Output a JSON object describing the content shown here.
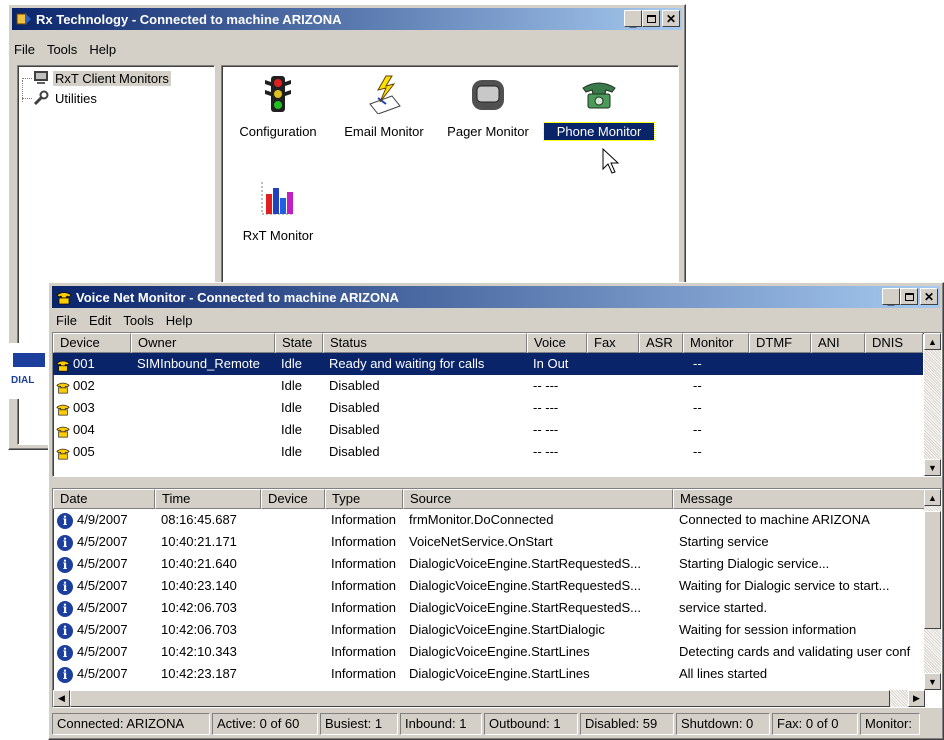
{
  "main_window": {
    "title": "Rx Technology - Connected to machine ARIZONA",
    "menu": [
      "File",
      "Tools",
      "Help"
    ],
    "tree": [
      {
        "label": "RxT Client Monitors",
        "icon": "monitor-icon",
        "selected": true
      },
      {
        "label": "Utilities",
        "icon": "wrench-icon",
        "selected": false
      }
    ],
    "icons": [
      {
        "label": "Configuration",
        "icon": "traffic-light-icon",
        "selected": false
      },
      {
        "label": "Email Monitor",
        "icon": "email-icon",
        "selected": false
      },
      {
        "label": "Pager Monitor",
        "icon": "pager-icon",
        "selected": false
      },
      {
        "label": "Phone Monitor",
        "icon": "phone-icon",
        "selected": true
      },
      {
        "label": "RxT Monitor",
        "icon": "bar-chart-icon",
        "selected": false
      }
    ],
    "logo_text": "DIAL"
  },
  "vnm_window": {
    "title": "Voice Net Monitor - Connected to machine ARIZONA",
    "menu": [
      "File",
      "Edit",
      "Tools",
      "Help"
    ],
    "device_columns": [
      "Device",
      "Owner",
      "State",
      "Status",
      "Voice",
      "Fax",
      "ASR",
      "Monitor",
      "DTMF",
      "ANI",
      "DNIS"
    ],
    "devices": [
      {
        "device": "001",
        "owner": "SIMInbound_Remote",
        "state": "Idle",
        "status": "Ready and waiting for calls",
        "voice": "In Out",
        "monitor": "--",
        "selected": true
      },
      {
        "device": "002",
        "owner": "",
        "state": "Idle",
        "status": "Disabled",
        "voice": "-- ---",
        "monitor": "--",
        "selected": false
      },
      {
        "device": "003",
        "owner": "",
        "state": "Idle",
        "status": "Disabled",
        "voice": "-- ---",
        "monitor": "--",
        "selected": false
      },
      {
        "device": "004",
        "owner": "",
        "state": "Idle",
        "status": "Disabled",
        "voice": "-- ---",
        "monitor": "--",
        "selected": false
      },
      {
        "device": "005",
        "owner": "",
        "state": "Idle",
        "status": "Disabled",
        "voice": "-- ---",
        "monitor": "--",
        "selected": false
      }
    ],
    "log_columns": [
      "Date",
      "Time",
      "Device",
      "Type",
      "Source",
      "Message"
    ],
    "log": [
      {
        "date": "4/9/2007",
        "time": "08:16:45.687",
        "device": "",
        "type": "Information",
        "source": "frmMonitor.DoConnected",
        "message": "Connected to machine ARIZONA"
      },
      {
        "date": "4/5/2007",
        "time": "10:40:21.171",
        "device": "",
        "type": "Information",
        "source": "VoiceNetService.OnStart",
        "message": "Starting service"
      },
      {
        "date": "4/5/2007",
        "time": "10:40:21.640",
        "device": "",
        "type": "Information",
        "source": "DialogicVoiceEngine.StartRequestedS...",
        "message": "Starting Dialogic service..."
      },
      {
        "date": "4/5/2007",
        "time": "10:40:23.140",
        "device": "",
        "type": "Information",
        "source": "DialogicVoiceEngine.StartRequestedS...",
        "message": "Waiting for Dialogic service to start..."
      },
      {
        "date": "4/5/2007",
        "time": "10:42:06.703",
        "device": "",
        "type": "Information",
        "source": "DialogicVoiceEngine.StartRequestedS...",
        "message": "service started."
      },
      {
        "date": "4/5/2007",
        "time": "10:42:06.703",
        "device": "",
        "type": "Information",
        "source": "DialogicVoiceEngine.StartDialogic",
        "message": "Waiting for session information"
      },
      {
        "date": "4/5/2007",
        "time": "10:42:10.343",
        "device": "",
        "type": "Information",
        "source": "DialogicVoiceEngine.StartLines",
        "message": "Detecting cards and validating user conf"
      },
      {
        "date": "4/5/2007",
        "time": "10:42:23.187",
        "device": "",
        "type": "Information",
        "source": "DialogicVoiceEngine.StartLines",
        "message": "All lines started"
      }
    ],
    "statusbar": [
      "Connected: ARIZONA",
      "Active: 0 of 60",
      "Busiest: 1",
      "Inbound: 1",
      "Outbound: 1",
      "Disabled: 59",
      "Shutdown: 0",
      "Fax: 0 of 0",
      "Monitor:"
    ]
  },
  "colors": {
    "title_active_start": "#0a246a",
    "title_active_end": "#a6caf0",
    "selection": "#0a246a",
    "face": "#d4d0c8",
    "phone_icon": "#ffcc00"
  }
}
